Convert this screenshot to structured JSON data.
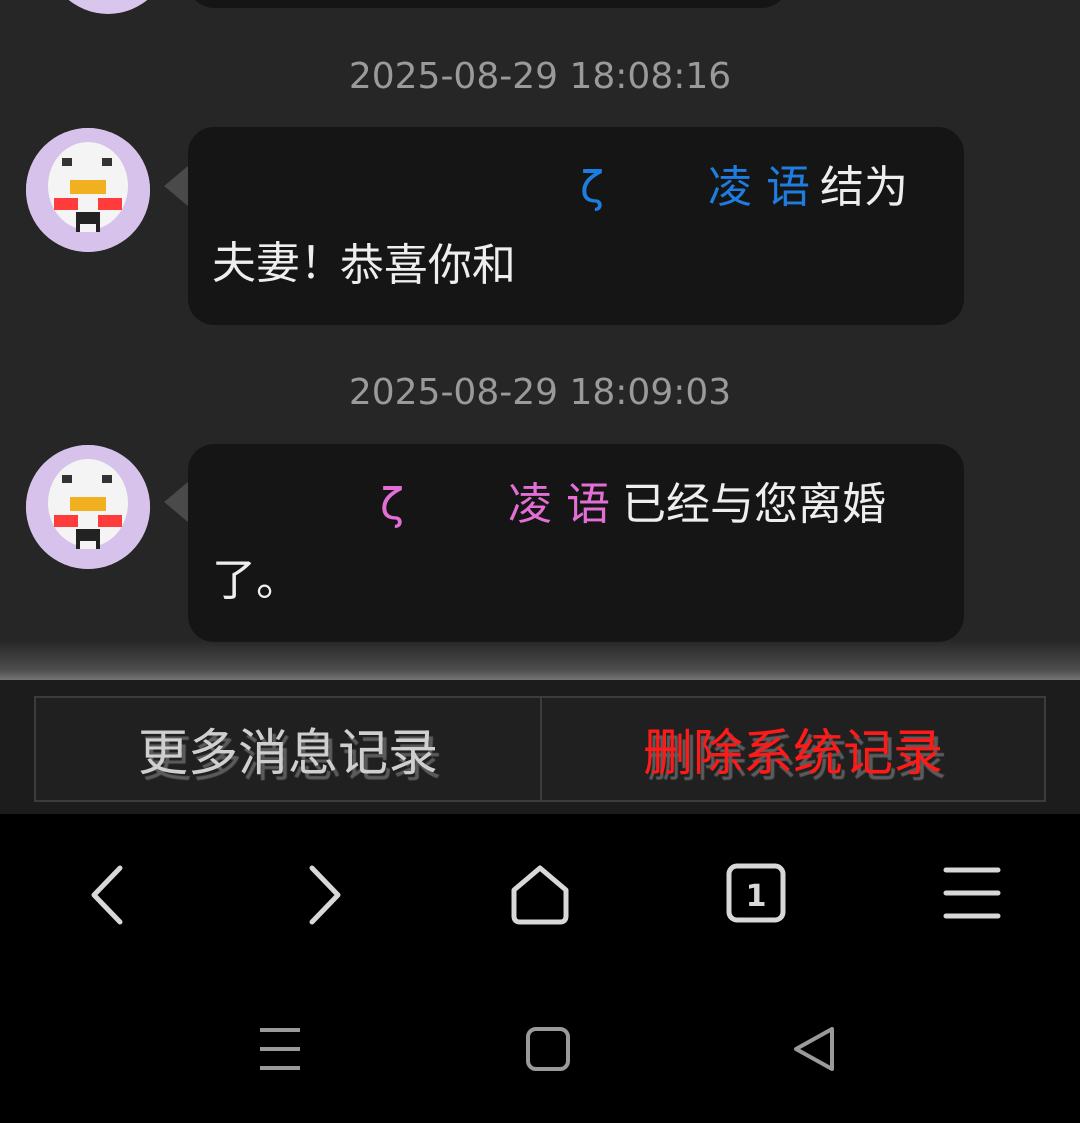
{
  "chat": {
    "messages": [
      {
        "timestamp": "2025-08-29 18:08:16",
        "line1": {
          "before": "恭喜你和",
          "name_part1": "ζ",
          "name_part2": "凌 语",
          "after": "结为"
        },
        "line2": "夫妻！",
        "name_color": "#1e7de0"
      },
      {
        "timestamp": "2025-08-29 18:09:03",
        "line1": {
          "name_part1": "ζ",
          "name_part2": "凌 语",
          "after": "已经与您离婚"
        },
        "line2": "了。",
        "name_color": "#e36fd6"
      }
    ]
  },
  "actions": {
    "more_records_label": "更多消息记录",
    "delete_system_label": "删除系统记录",
    "delete_color": "#ff1a1a"
  },
  "browser_nav": {
    "tab_count": "1",
    "icons": [
      "back-icon",
      "forward-icon",
      "home-icon",
      "tabs-icon",
      "menu-icon"
    ]
  },
  "system_nav": {
    "icons": [
      "recent-apps-icon",
      "home-square-icon",
      "back-triangle-icon"
    ]
  }
}
